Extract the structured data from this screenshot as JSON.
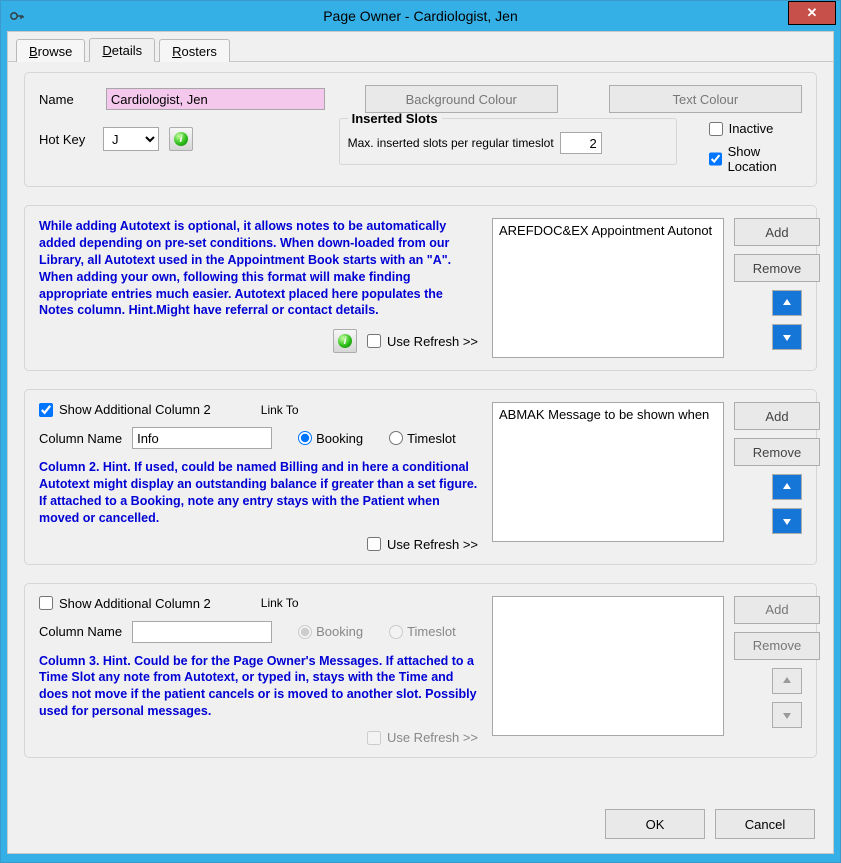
{
  "window": {
    "title": "Page Owner - Cardiologist, Jen"
  },
  "tabs": {
    "browse": "Browse",
    "details": "Details",
    "rosters": "Rosters"
  },
  "topGroup": {
    "nameLabel": "Name",
    "nameValue": "Cardiologist, Jen",
    "bgColourBtn": "Background Colour",
    "textColourBtn": "Text Colour",
    "hotKeyLabel": "Hot Key",
    "hotKeyValue": "J",
    "insertedLegend": "Inserted Slots",
    "insertedText": "Max. inserted slots per regular timeslot",
    "insertedValue": "2",
    "inactiveLabel": "Inactive",
    "showLocationLabel": "Show Location"
  },
  "autotext": {
    "hint": "While adding Autotext is optional, it allows notes to be automatically added depending on pre-set conditions.  When down-loaded from our Library, all Autotext used in the Appointment Book starts with an \"A\". When adding your own, following this format will make finding appropriate entries much easier. Autotext placed here populates the Notes column. Hint.Might have referral or contact details.",
    "useRefresh": "Use Refresh >>",
    "listItem": "AREFDOC&EX Appointment Autonot",
    "addBtn": "Add",
    "removeBtn": "Remove"
  },
  "col2": {
    "showLabel": "Show Additional Column 2",
    "showChecked": true,
    "columnNameLabel": "Column Name",
    "columnNameValue": "Info",
    "linkToLabel": "Link To",
    "bookingLabel": "Booking",
    "timeslotLabel": "Timeslot",
    "hint": "Column 2.  Hint.  If used, could be named Billing and in here a conditional Autotext might display an outstanding balance if greater than a set figure.  If attached to a Booking, note any entry stays with the Patient when moved or cancelled.",
    "useRefresh": "Use Refresh >>",
    "listItem": "ABMAK Message to be shown when",
    "addBtn": "Add",
    "removeBtn": "Remove"
  },
  "col3": {
    "showLabel": "Show Additional Column 2",
    "showChecked": false,
    "columnNameLabel": "Column Name",
    "columnNameValue": "",
    "linkToLabel": "Link To",
    "bookingLabel": "Booking",
    "timeslotLabel": "Timeslot",
    "hint": "Column 3. Hint. Could be for the Page Owner's Messages.  If attached to a Time Slot any note from Autotext, or typed in, stays with the Time and does not move if the patient cancels or is moved to another slot.  Possibly used for personal messages.",
    "useRefresh": "Use Refresh >>",
    "addBtn": "Add",
    "removeBtn": "Remove"
  },
  "footer": {
    "ok": "OK",
    "cancel": "Cancel"
  }
}
